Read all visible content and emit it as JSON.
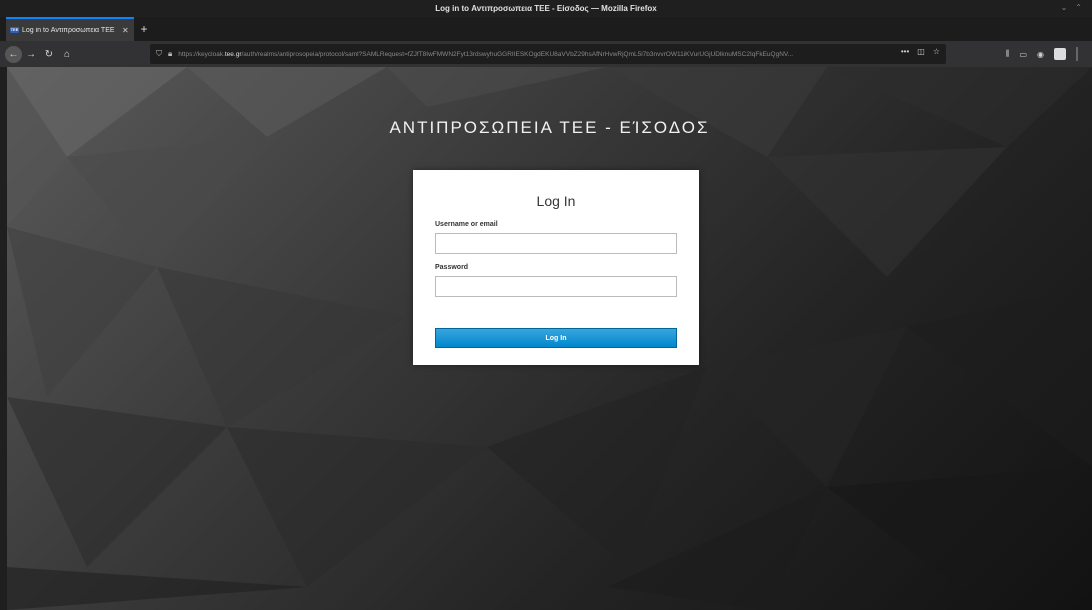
{
  "window": {
    "title": "Log in to Αντιπροσωπεια ΤΕΕ - Είσοδος — Mozilla Firefox"
  },
  "tabs": [
    {
      "label": "Log in to Αντιπροσωπεια ΤΕΕ",
      "favicon": "TEE"
    }
  ],
  "navbar": {
    "url_prefix": "https://keycloak.",
    "url_domain": "tee.gr",
    "url_rest": "/auth/realms/antiprosopeia/protocol/saml?SAMLRequest=fZJfT8IwFMWN2Fyt13rdswyhuGGRIIESKOgdEKU8aVVbZ29hsAfNrHvwRjQmL5l7b3nvvrOW11iKVurUGjUDlknuMSC2IqFkEuQgNV..."
  },
  "page": {
    "heading": "ΑΝΤΙΠΡΟΣΩΠΕΙΑ ΤΕΕ - ΕΊΣΟΔΟΣ"
  },
  "login_form": {
    "title": "Log In",
    "username_label": "Username or email",
    "username_value": "",
    "password_label": "Password",
    "password_value": "",
    "submit_label": "Log In"
  },
  "colors": {
    "accent": "#0a84ff",
    "button": "#0088ce"
  }
}
